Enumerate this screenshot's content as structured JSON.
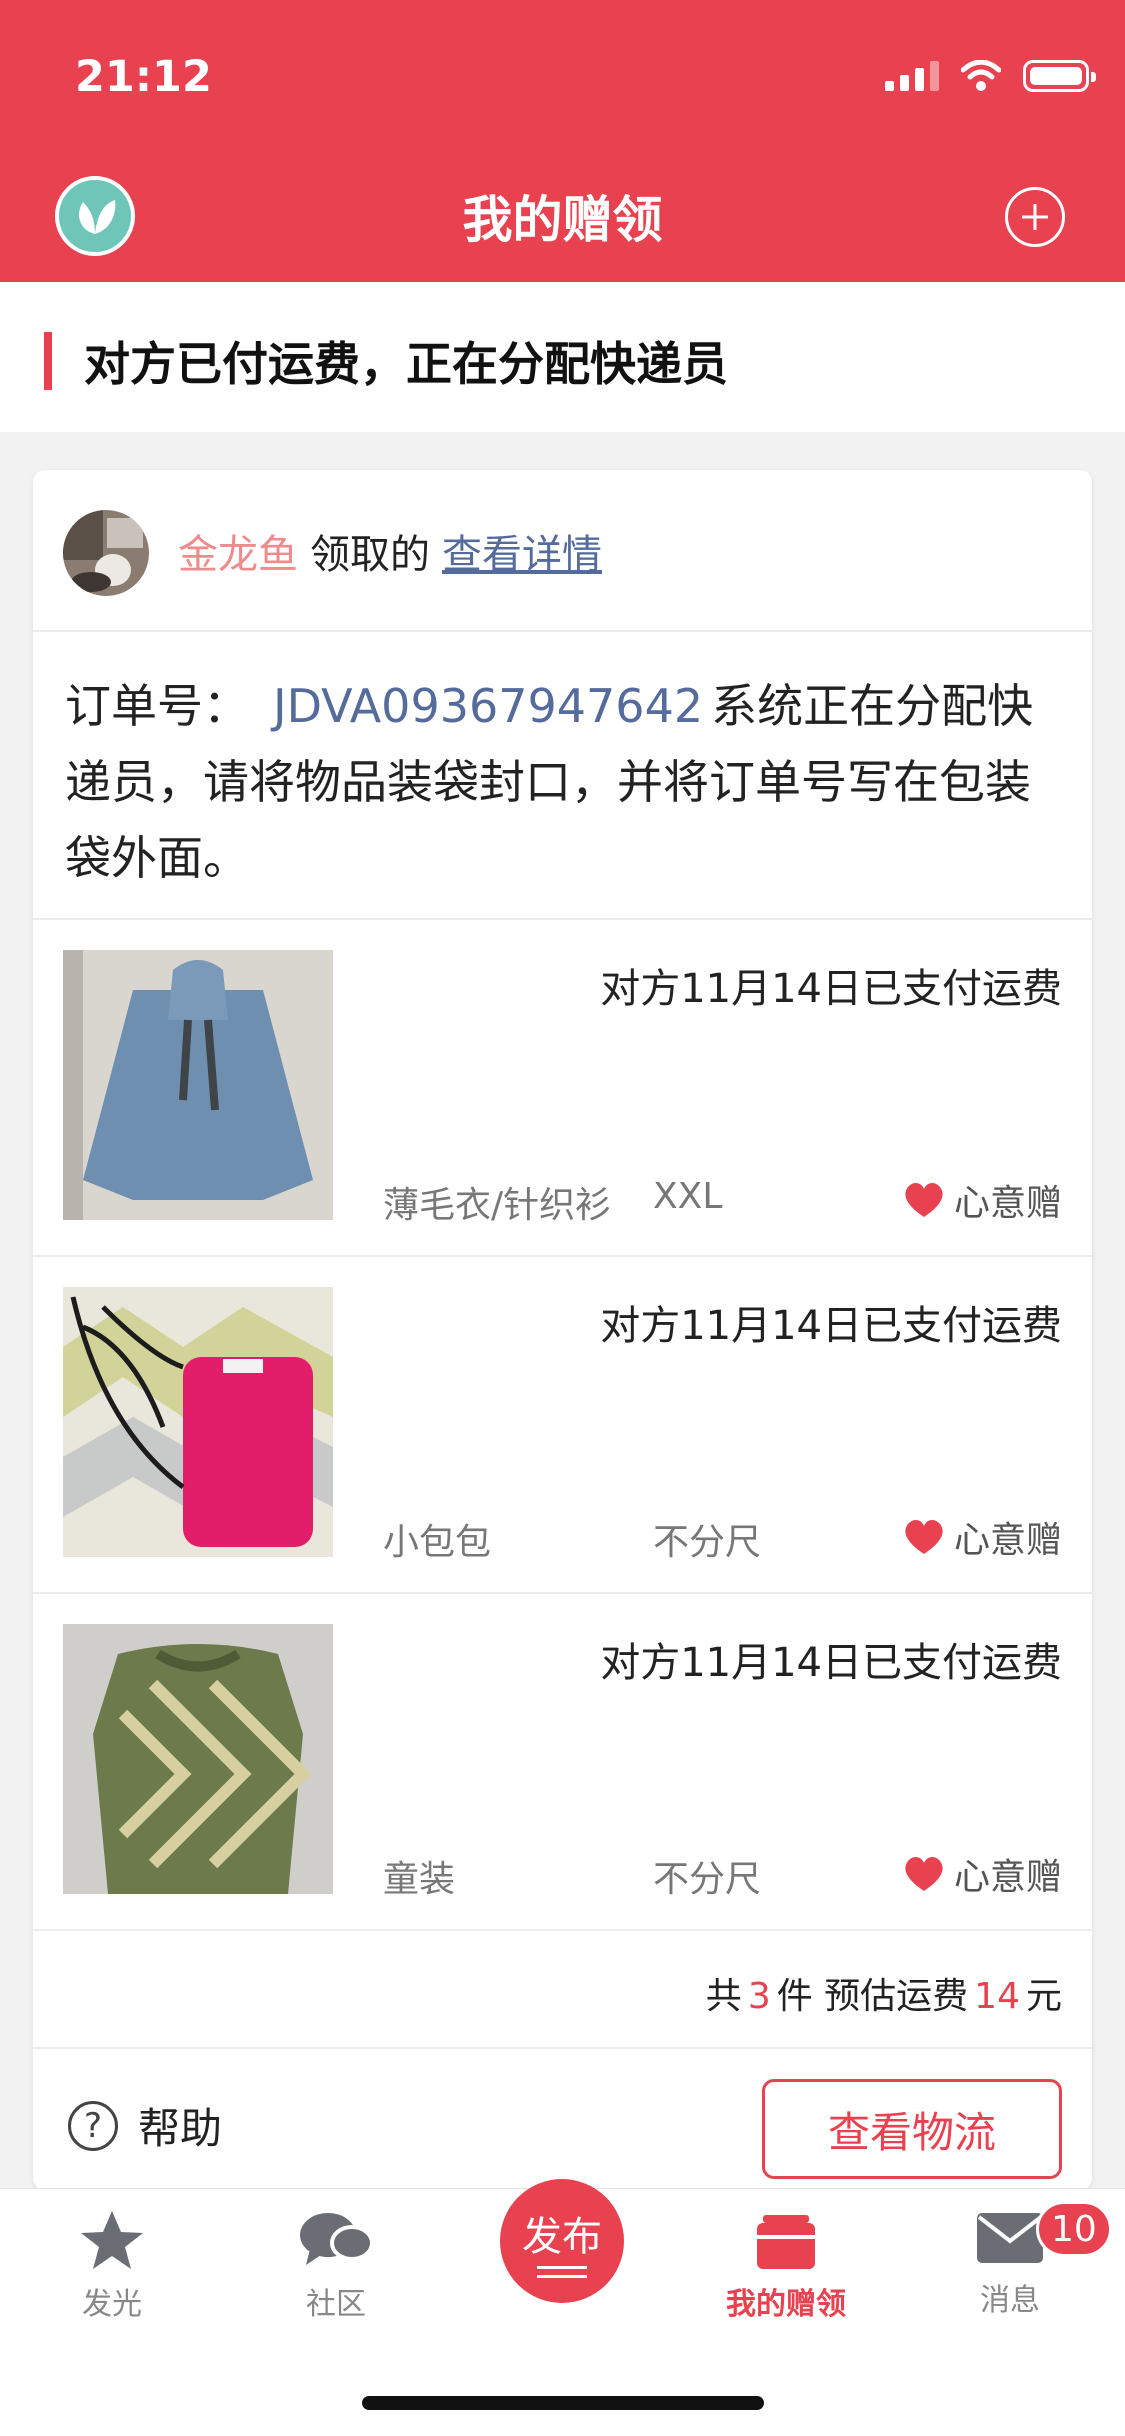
{
  "status_bar": {
    "time": "21:12"
  },
  "header": {
    "title": "我的赠领"
  },
  "status_banner": {
    "text": "对方已付运费，正在分配快递员"
  },
  "order": {
    "nickname": "金龙鱼",
    "claim_text": "领取的",
    "detail_link": "查看详情",
    "order_label": "订单号：",
    "order_number": "JDVA09367947642",
    "instruction": "系统正在分配快递员，请将物品装袋封口，并将订单号写在包装袋外面。"
  },
  "items": [
    {
      "status": "对方11月14日已支付运费",
      "category": "薄毛衣/针织衫",
      "size": "XXL",
      "tag": "心意赠"
    },
    {
      "status": "对方11月14日已支付运费",
      "category": "小包包",
      "size": "不分尺",
      "tag": "心意赠"
    },
    {
      "status": "对方11月14日已支付运费",
      "category": "童装",
      "size": "不分尺",
      "tag": "心意赠"
    }
  ],
  "summary": {
    "prefix": "共",
    "count": "3",
    "unit": "件 预估运费",
    "fee": "14",
    "currency": "元"
  },
  "actions": {
    "help_label": "帮助",
    "logistics_button": "查看物流"
  },
  "tabbar": {
    "tabs": [
      {
        "label": "发光",
        "icon": "star-icon"
      },
      {
        "label": "社区",
        "icon": "chat-bubbles-icon"
      },
      {
        "label": "发布",
        "icon": "publish-icon"
      },
      {
        "label": "我的赠领",
        "icon": "gift-box-icon"
      },
      {
        "label": "消息",
        "icon": "envelope-icon"
      }
    ],
    "message_badge": "10"
  },
  "colors": {
    "brand_red": "#e8414f",
    "link_blue": "#556b9c",
    "nickname_pink": "#ef8b8b"
  }
}
